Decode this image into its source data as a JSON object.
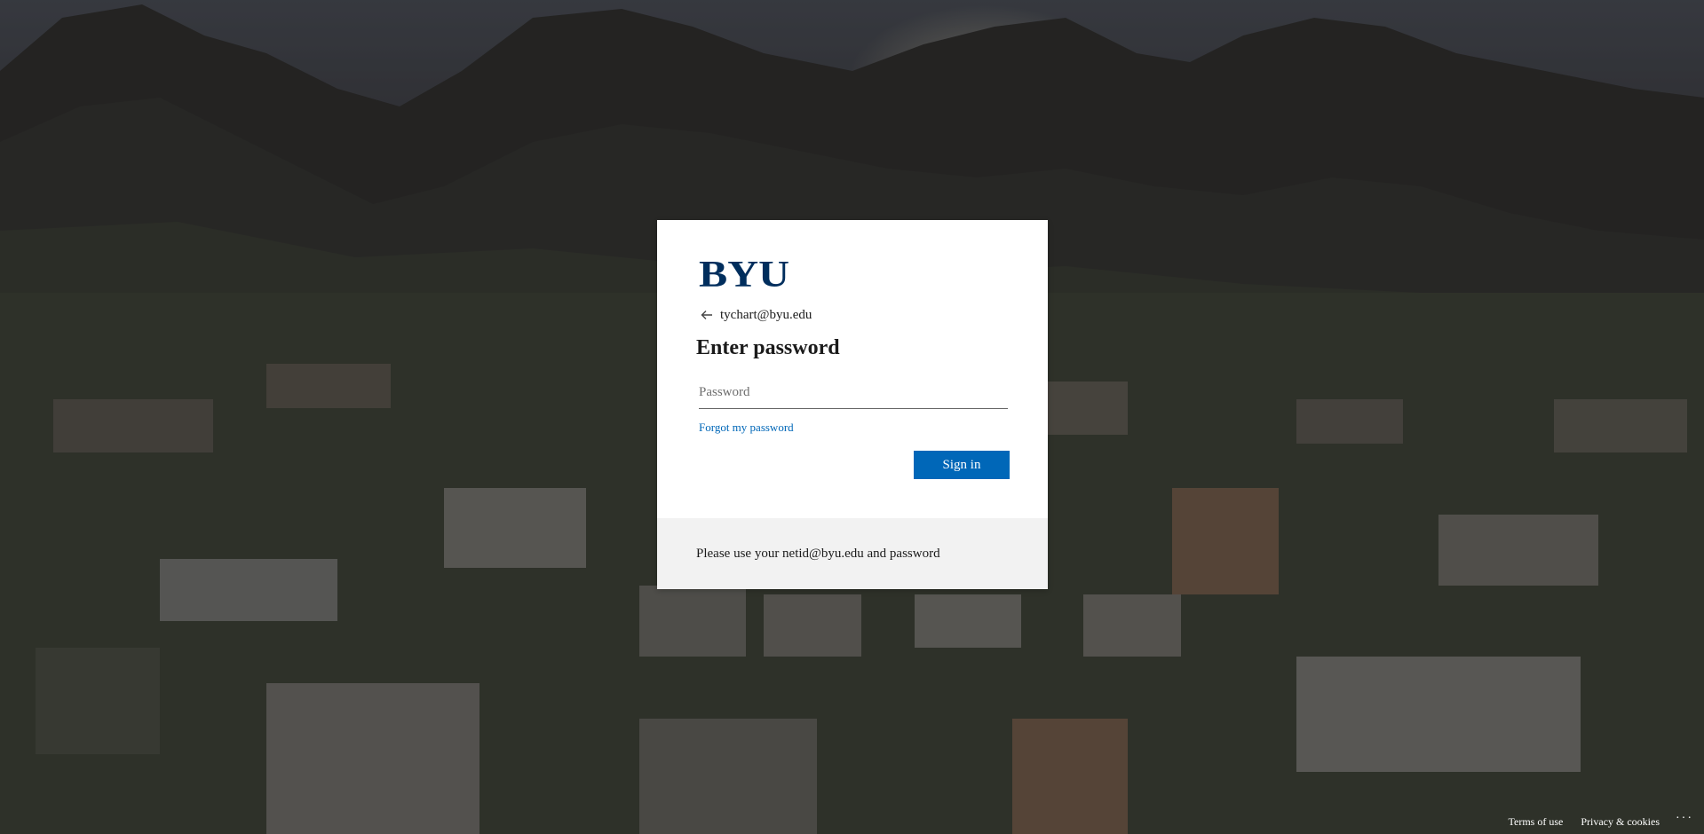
{
  "logo": {
    "text": "BYU",
    "color": "#002e5d"
  },
  "identity": {
    "email": "tychart@byu.edu",
    "back_icon": "arrow-left-icon"
  },
  "heading": {
    "title": "Enter password"
  },
  "password": {
    "placeholder": "Password",
    "value": ""
  },
  "links": {
    "forgot": "Forgot my password"
  },
  "buttons": {
    "signin": "Sign in"
  },
  "info": {
    "text": "Please use your netid@byu.edu and password"
  },
  "footer": {
    "terms": "Terms of use",
    "privacy": "Privacy & cookies",
    "more": "···"
  },
  "colors": {
    "accent": "#0067b8",
    "brand": "#002e5d",
    "footer_bg": "#f2f2f2"
  }
}
